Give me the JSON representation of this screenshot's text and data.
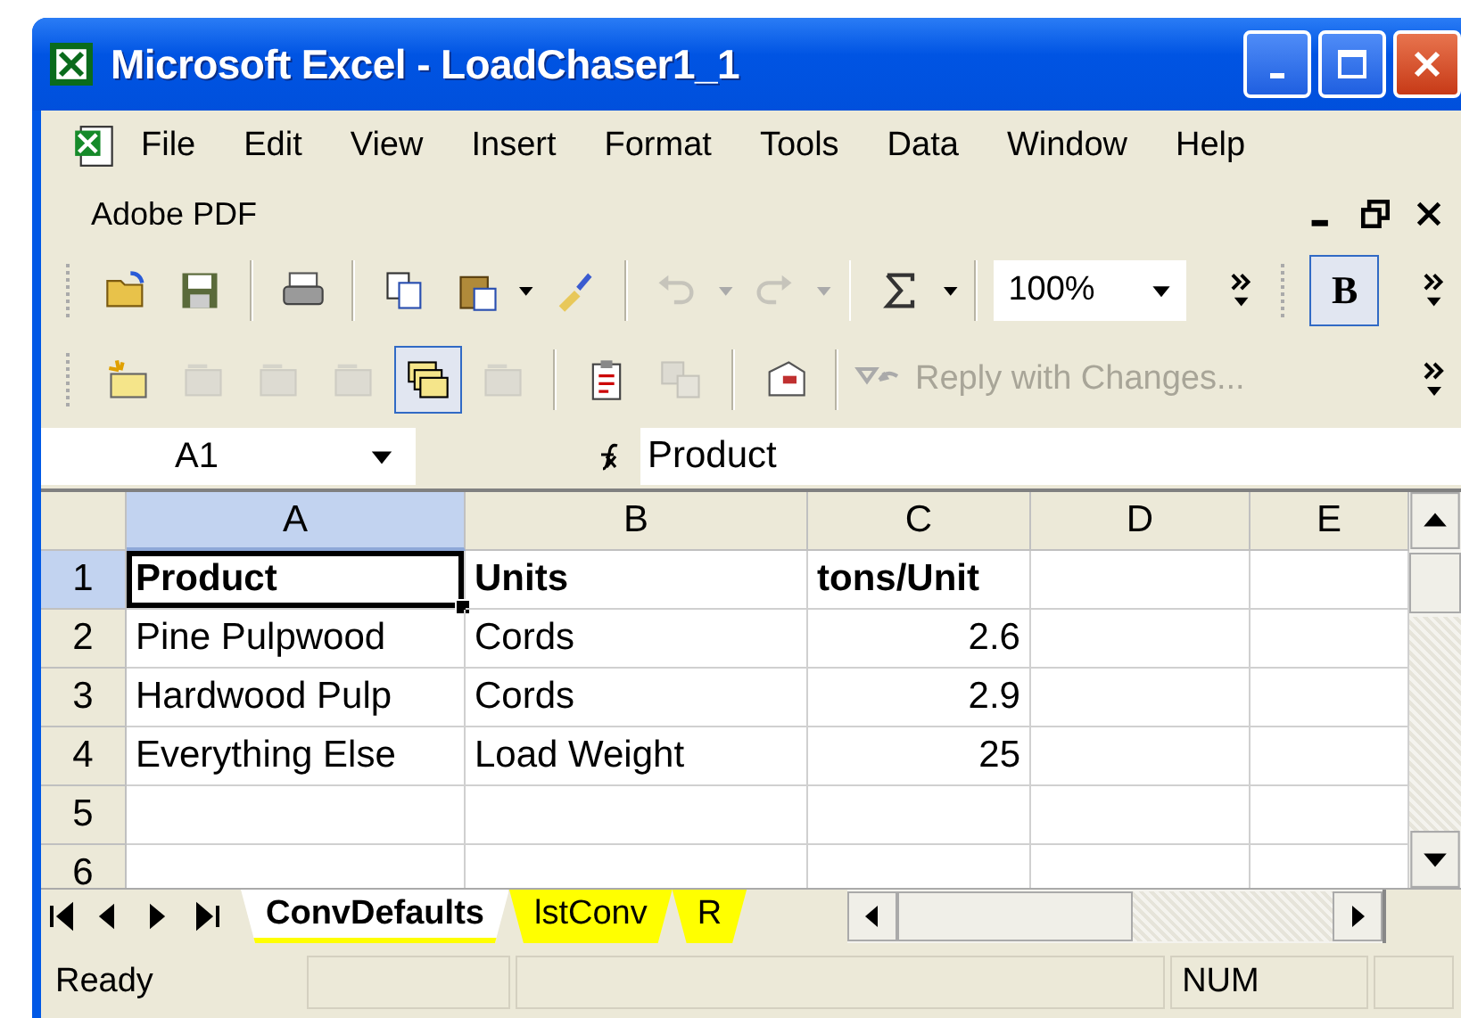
{
  "window": {
    "title": "Microsoft Excel - LoadChaser1_1"
  },
  "menu": [
    {
      "label": "File"
    },
    {
      "label": "Edit"
    },
    {
      "label": "View"
    },
    {
      "label": "Insert"
    },
    {
      "label": "Format"
    },
    {
      "label": "Tools"
    },
    {
      "label": "Data"
    },
    {
      "label": "Window"
    },
    {
      "label": "Help"
    }
  ],
  "adobe_toolbar": {
    "label": "Adobe PDF"
  },
  "standard_toolbar": [
    {
      "disabled": false,
      "pressed": false
    },
    {
      "disabled": false,
      "pressed": false
    },
    {
      "disabled": false,
      "pressed": false
    },
    {
      "disabled": false,
      "pressed": false
    },
    {
      "disabled": false,
      "pressed": false
    },
    {
      "disabled": false,
      "pressed": false
    },
    {
      "disabled": true,
      "pressed": false
    },
    {
      "disabled": true,
      "pressed": false
    },
    {
      "disabled": false,
      "pressed": false
    }
  ],
  "zoom": {
    "value": "100%"
  },
  "bold_button": {
    "label": "B",
    "pressed": true
  },
  "reviewing_toolbar": [
    {
      "disabled": false,
      "pressed": false
    },
    {
      "disabled": true,
      "pressed": false
    },
    {
      "disabled": true,
      "pressed": false
    },
    {
      "disabled": true,
      "pressed": false
    },
    {
      "disabled": false,
      "pressed": true
    },
    {
      "disabled": true,
      "pressed": false
    },
    {
      "disabled": false,
      "pressed": false
    },
    {
      "disabled": true,
      "pressed": false
    },
    {
      "disabled": false,
      "pressed": false
    }
  ],
  "reply_button": {
    "label": "Reply with Changes...",
    "disabled": true
  },
  "name_box": {
    "value": "A1"
  },
  "formula_bar": {
    "value": "Product"
  },
  "sheet": {
    "columns": [
      {
        "label": "A",
        "selected": true
      },
      {
        "label": "B",
        "selected": false
      },
      {
        "label": "C",
        "selected": false
      },
      {
        "label": "D",
        "selected": false
      },
      {
        "label": "E",
        "selected": false
      }
    ],
    "rows": [
      {
        "label": "1",
        "selected": true,
        "cells": [
          {
            "text": "Product",
            "kind": "text",
            "bold": true,
            "active": true
          },
          {
            "text": "Units",
            "kind": "text",
            "bold": true,
            "active": false
          },
          {
            "text": "tons/Unit",
            "kind": "text",
            "bold": true,
            "active": false
          }
        ]
      },
      {
        "label": "2",
        "selected": false,
        "cells": [
          {
            "text": "Pine Pulpwood",
            "kind": "text",
            "bold": false,
            "active": false
          },
          {
            "text": "Cords",
            "kind": "text",
            "bold": false,
            "active": false
          },
          {
            "text": "2.6",
            "kind": "number",
            "bold": false,
            "active": false
          }
        ]
      },
      {
        "label": "3",
        "selected": false,
        "cells": [
          {
            "text": "Hardwood Pulp",
            "kind": "text",
            "bold": false,
            "active": false
          },
          {
            "text": "Cords",
            "kind": "text",
            "bold": false,
            "active": false
          },
          {
            "text": "2.9",
            "kind": "number",
            "bold": false,
            "active": false
          }
        ]
      },
      {
        "label": "4",
        "selected": false,
        "cells": [
          {
            "text": "Everything Else",
            "kind": "text",
            "bold": false,
            "active": false
          },
          {
            "text": "Load Weight",
            "kind": "text",
            "bold": false,
            "active": false
          },
          {
            "text": "25",
            "kind": "number",
            "bold": false,
            "active": false
          }
        ]
      },
      {
        "label": "5",
        "selected": false
      },
      {
        "label": "6",
        "selected": false
      }
    ]
  },
  "sheet_tabs": [
    {
      "label": "ConvDefaults",
      "selected": true,
      "color": "#ffff00"
    },
    {
      "label": "lstConv",
      "selected": false,
      "color": "#ffff00"
    },
    {
      "label": "R",
      "selected": false,
      "color": "#ffff00"
    }
  ],
  "status_bar": {
    "status": "Ready",
    "indicator": "NUM"
  }
}
